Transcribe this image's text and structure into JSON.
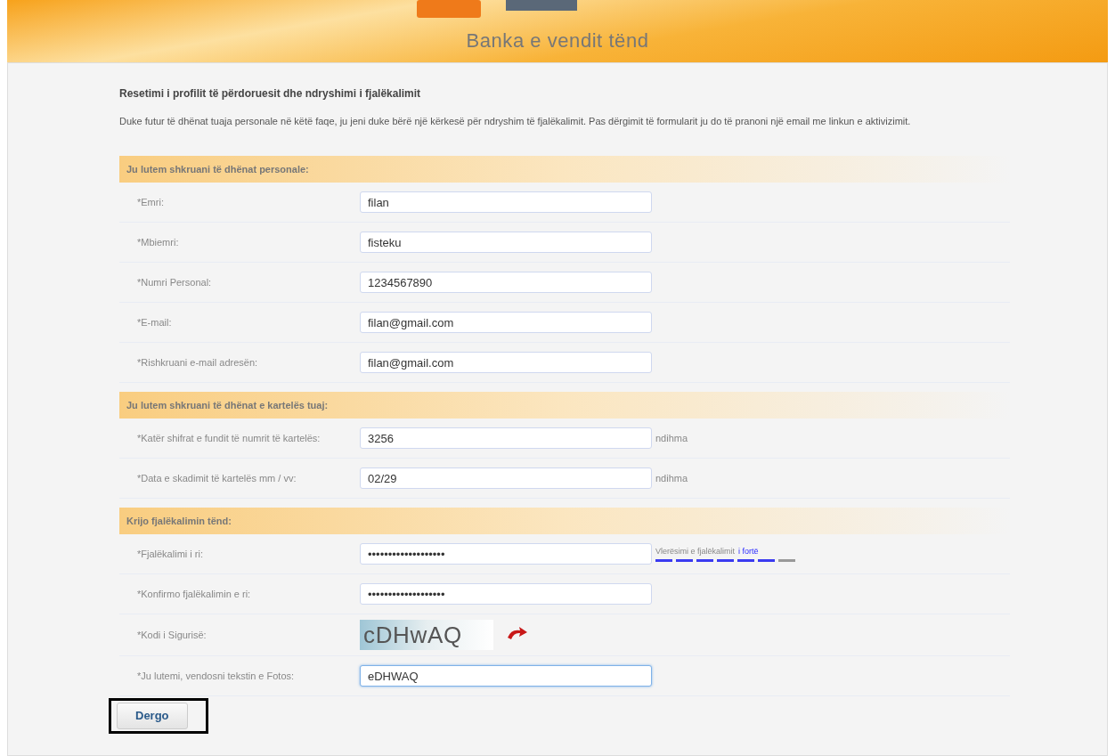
{
  "header": {
    "tagline": "Banka e vendit tënd"
  },
  "page": {
    "title": "Resetimi i profilit të përdoruesit dhe ndryshimi i fjalëkalimit",
    "intro": "Duke futur të dhënat tuaja personale në këtë faqe, ju jeni duke bërë një kërkesë për ndryshim të fjalëkalimit. Pas dërgimit të formularit ju do të pranoni një email me linkun e aktivizimit."
  },
  "sections": [
    {
      "title": "Ju lutem shkruani të dhënat personale:",
      "fields": [
        {
          "kind": "text",
          "label": "*Emri:",
          "value": "filan"
        },
        {
          "kind": "text",
          "label": "*Mbiemri:",
          "value": "fisteku"
        },
        {
          "kind": "text",
          "label": "*Numri Personal:",
          "value": "1234567890"
        },
        {
          "kind": "text",
          "label": "*E-mail:",
          "value": "filan@gmail.com"
        },
        {
          "kind": "text",
          "label": "*Rishkruani e-mail adresën:",
          "value": "filan@gmail.com"
        }
      ]
    },
    {
      "title": "Ju lutem shkruani të dhënat e kartelës tuaj:",
      "fields": [
        {
          "kind": "help",
          "label": "*Katër shifrat e fundit të numrit të kartelës:",
          "value": "3256",
          "help": "ndihma"
        },
        {
          "kind": "help",
          "label": "*Data e skadimit të kartelës mm / vv:",
          "value": "02/29",
          "help": "ndihma"
        }
      ]
    },
    {
      "title": "Krijo fjalëkalimin tënd:",
      "fields": [
        {
          "kind": "strength",
          "label": "*Fjalëkalimi i ri:",
          "value": "•••••••••••••••••••",
          "strength_label": "Vlerësimi e fjalëkalimit",
          "strength_value": "i fortë",
          "level": 0.86
        },
        {
          "kind": "text",
          "label": "*Konfirmo fjalëkalimin e ri:",
          "value": "•••••••••••••••••••"
        },
        {
          "kind": "captcha",
          "label": "*Kodi i Sigurisë:",
          "captcha": "cDHwAQ"
        },
        {
          "kind": "focused",
          "label": "*Ju lutemi, vendosni tekstin e Fotos:",
          "value": "eDHWAQ"
        }
      ]
    }
  ],
  "submit": {
    "label": "Dergo"
  }
}
